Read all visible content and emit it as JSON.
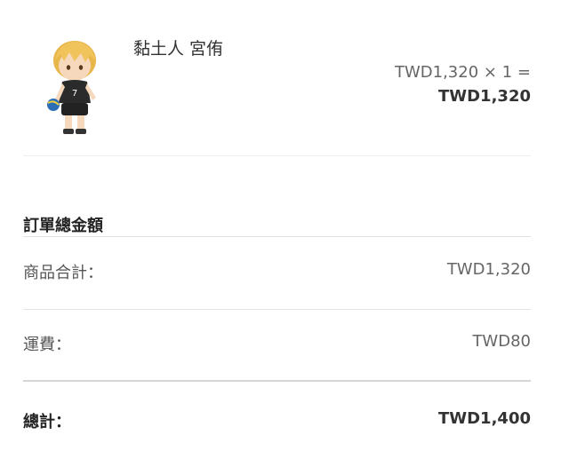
{
  "item": {
    "name": "黏土人 宮侑",
    "unit_price": "TWD1,320",
    "multiply_sign": "×",
    "quantity": "1",
    "equals_sign": "=",
    "line_total": "TWD1,320",
    "image": "nendoroid-figure-image"
  },
  "summary": {
    "title": "訂單總金額",
    "subtotal_label": "商品合計：",
    "subtotal_value": "TWD1,320",
    "shipping_label": "運費：",
    "shipping_value": "TWD80",
    "total_label": "總計：",
    "total_value": "TWD1,400"
  }
}
